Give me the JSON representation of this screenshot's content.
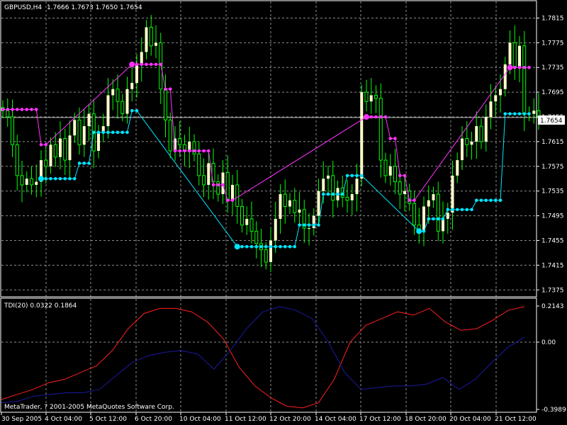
{
  "chart_data": [
    {
      "type": "candlestick",
      "title": "GBPUSD,H4",
      "ohlc_label": "1.7666 1.7673 1.7650 1.7654",
      "current_price": 1.7654,
      "current_price_label": "1.7654",
      "ylim": [
        1.7365,
        1.7835
      ],
      "y_ticks": [
        "1.7815",
        "1.7775",
        "1.7735",
        "1.7695",
        "1.7655",
        "1.7615",
        "1.7575",
        "1.7535",
        "1.7495",
        "1.7455",
        "1.7415",
        "1.7375"
      ],
      "colors": {
        "bull": "#ffffcc",
        "wick": "#00ff00",
        "bear": "#000000",
        "grid": "#8c8c8c",
        "stop_up": "#00e5ff",
        "stop_down": "#ff33ff",
        "price_line": "#c0c0c0"
      },
      "candles_close": [
        1.7665,
        1.7655,
        1.761,
        1.756,
        1.7545,
        1.7555,
        1.7545,
        1.755,
        1.7585,
        1.7575,
        1.761,
        1.759,
        1.762,
        1.7585,
        1.7625,
        1.765,
        1.761,
        1.764,
        1.766,
        1.76,
        1.763,
        1.764,
        1.769,
        1.77,
        1.768,
        1.766,
        1.77,
        1.771,
        1.774,
        1.776,
        1.78,
        1.777,
        1.7775,
        1.77,
        1.765,
        1.76,
        1.762,
        1.761,
        1.76,
        1.7615,
        1.7595,
        1.756,
        1.7545,
        1.758,
        1.755,
        1.753,
        1.7565,
        1.752,
        1.7545,
        1.751,
        1.748,
        1.749,
        1.747,
        1.745,
        1.744,
        1.742,
        1.7455,
        1.749,
        1.753,
        1.751,
        1.752,
        1.75,
        1.7505,
        1.7475,
        1.7475,
        1.7495,
        1.7535,
        1.7555,
        1.756,
        1.752,
        1.754,
        1.7525,
        1.752,
        1.753,
        1.7555,
        1.7695,
        1.768,
        1.769,
        1.7685,
        1.7585,
        1.756,
        1.7575,
        1.755,
        1.753,
        1.7535,
        1.7515,
        1.748,
        1.747,
        1.751,
        1.752,
        1.753,
        1.747,
        1.749,
        1.75,
        1.756,
        1.7585,
        1.762,
        1.761,
        1.7615,
        1.764,
        1.7615,
        1.7655,
        1.768,
        1.769,
        1.77,
        1.774,
        1.7775,
        1.7735,
        1.777,
        1.766,
        1.766,
        1.7665,
        1.7654
      ],
      "stop_down": [
        {
          "from": 0,
          "to": 7,
          "value": 1.7667,
          "start": false
        },
        {
          "from": 8,
          "to": 9,
          "value": 1.761,
          "start": false
        },
        {
          "from": 27,
          "to": 33,
          "value": 1.774,
          "start": true
        },
        {
          "from": 34,
          "to": 35,
          "value": 1.77,
          "start": false
        },
        {
          "from": 36,
          "to": 43,
          "value": 1.76,
          "start": false
        },
        {
          "from": 44,
          "to": 46,
          "value": 1.7545,
          "start": false
        },
        {
          "from": 47,
          "to": 48,
          "value": 1.752,
          "start": false
        },
        {
          "from": 76,
          "to": 80,
          "value": 1.7655,
          "start": true
        },
        {
          "from": 81,
          "to": 82,
          "value": 1.762,
          "start": false
        },
        {
          "from": 83,
          "to": 84,
          "value": 1.756,
          "start": false
        },
        {
          "from": 85,
          "to": 86,
          "value": 1.752,
          "start": false
        },
        {
          "from": 106,
          "to": 110,
          "value": 1.7735,
          "start": true
        }
      ],
      "stop_up": [
        {
          "from": 8,
          "to": 15,
          "value": 1.7555,
          "start": true
        },
        {
          "from": 16,
          "to": 18,
          "value": 1.758,
          "start": false
        },
        {
          "from": 19,
          "to": 26,
          "value": 1.763,
          "start": false
        },
        {
          "from": 27,
          "to": 28,
          "value": 1.7665,
          "start": false
        },
        {
          "from": 49,
          "to": 61,
          "value": 1.7445,
          "start": true
        },
        {
          "from": 62,
          "to": 66,
          "value": 1.748,
          "start": false
        },
        {
          "from": 67,
          "to": 71,
          "value": 1.753,
          "start": false
        },
        {
          "from": 72,
          "to": 75,
          "value": 1.756,
          "start": false
        },
        {
          "from": 87,
          "to": 88,
          "value": 1.747,
          "start": true
        },
        {
          "from": 89,
          "to": 92,
          "value": 1.749,
          "start": false
        },
        {
          "from": 93,
          "to": 98,
          "value": 1.7505,
          "start": false
        },
        {
          "from": 99,
          "to": 104,
          "value": 1.752,
          "start": false
        },
        {
          "from": 105,
          "to": 110,
          "value": 1.766,
          "start": false
        }
      ]
    },
    {
      "type": "line",
      "title": "TDI(20) 0.0322 0.1864",
      "ylim": [
        -0.3989,
        0.2143
      ],
      "y_ticks": [
        "0.2143",
        "0.00",
        "-0.3989"
      ],
      "x": [
        "30 Sep 2005",
        "4 Oct 04:00",
        "5 Oct 12:00",
        "6 Oct 20:00",
        "10 Oct 04:00",
        "11 Oct 12:00",
        "12 Oct 20:00",
        "14 Oct 04:00",
        "17 Oct 12:00",
        "18 Oct 20:00",
        "20 Oct 04:00",
        "21 Oct 12:00"
      ],
      "series": [
        {
          "color": "#ff2020",
          "values": [
            -0.34,
            -0.31,
            -0.28,
            -0.24,
            -0.22,
            -0.18,
            -0.14,
            -0.05,
            0.08,
            0.17,
            0.2,
            0.2,
            0.18,
            0.12,
            0.02,
            -0.15,
            -0.26,
            -0.33,
            -0.38,
            -0.39,
            -0.36,
            -0.22,
            0.0,
            0.1,
            0.14,
            0.18,
            0.16,
            0.2,
            0.12,
            0.07,
            0.08,
            0.13,
            0.19,
            0.21
          ]
        },
        {
          "color": "#1a1aa0",
          "values": [
            -0.36,
            -0.35,
            -0.32,
            -0.31,
            -0.3,
            -0.3,
            -0.28,
            -0.2,
            -0.12,
            -0.08,
            -0.06,
            -0.05,
            -0.07,
            -0.16,
            -0.05,
            0.08,
            0.18,
            0.21,
            0.19,
            0.14,
            0.0,
            -0.18,
            -0.28,
            -0.27,
            -0.26,
            -0.26,
            -0.25,
            -0.21,
            -0.28,
            -0.22,
            -0.12,
            -0.03,
            0.03
          ]
        }
      ]
    }
  ],
  "footer": "MetaTrader, ? 2001-2005 MetaQuotes Software Corp."
}
